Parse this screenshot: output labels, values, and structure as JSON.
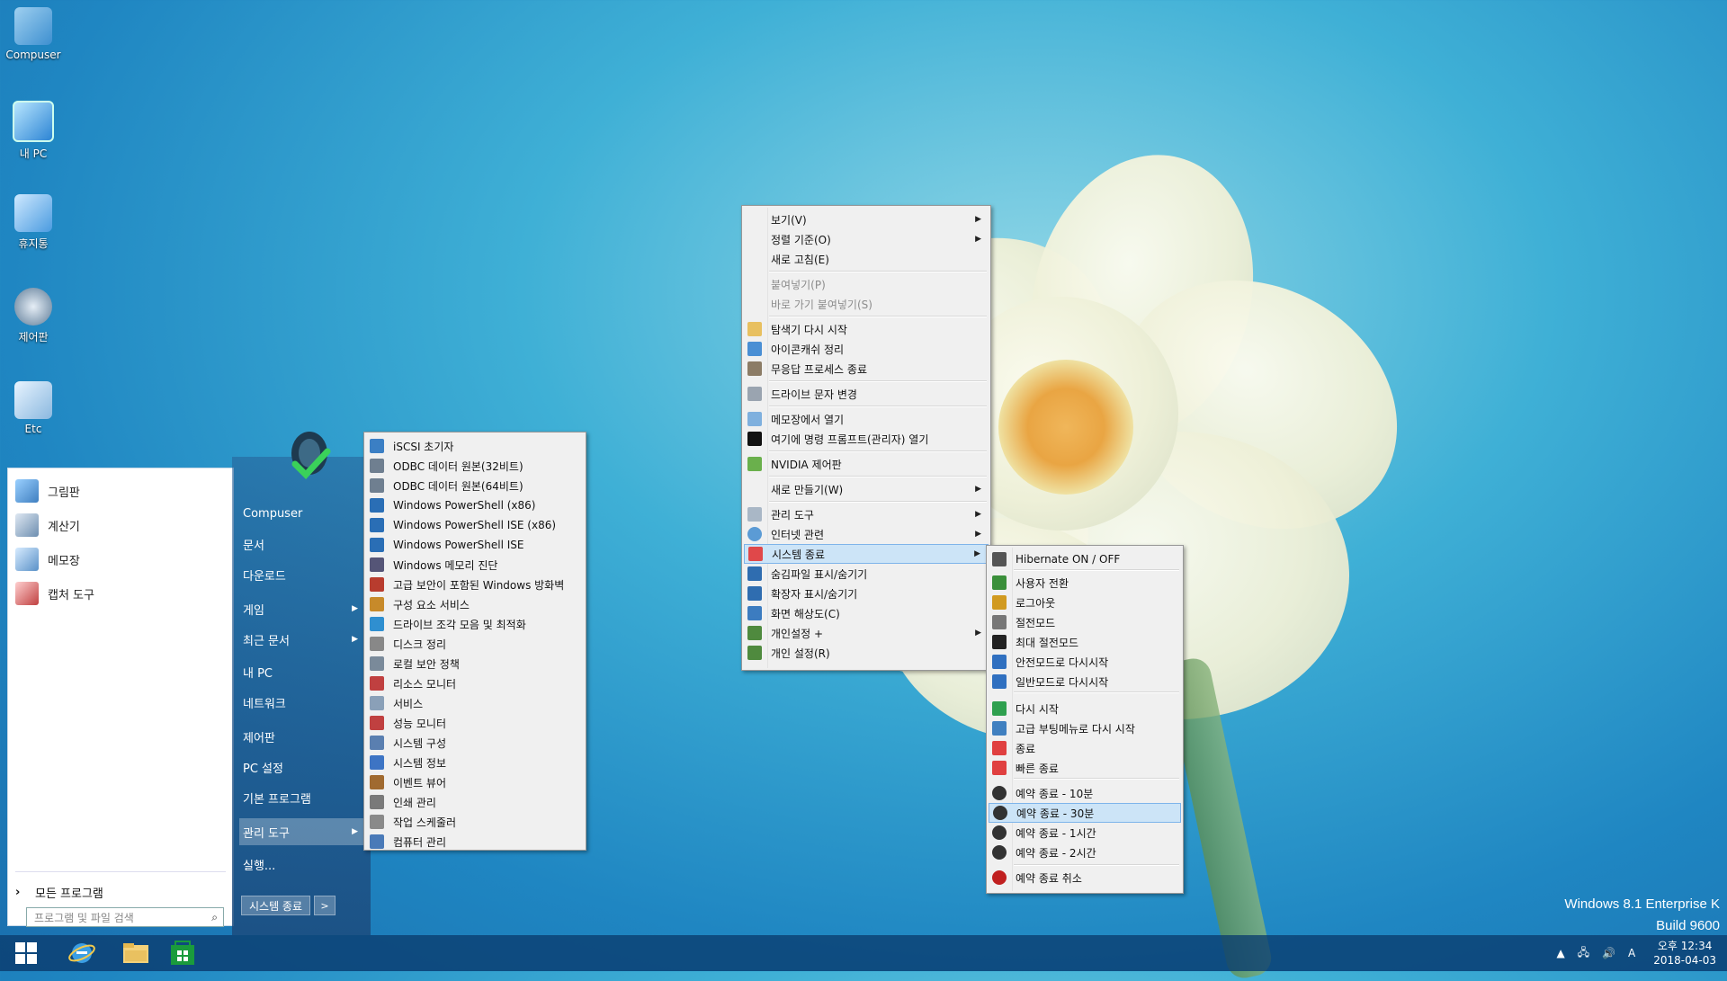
{
  "desktop_icons": [
    {
      "label": "Compuser",
      "icon": "user-folder-icon"
    },
    {
      "label": "내 PC",
      "icon": "computer-icon"
    },
    {
      "label": "휴지통",
      "icon": "recycle-bin-icon"
    },
    {
      "label": "제어판",
      "icon": "control-panel-icon"
    },
    {
      "label": "Etc",
      "icon": "folder-icon"
    }
  ],
  "start_menu": {
    "programs": [
      {
        "label": "그림판",
        "icon": "paint-icon"
      },
      {
        "label": "계산기",
        "icon": "calculator-icon"
      },
      {
        "label": "메모장",
        "icon": "notepad-icon"
      },
      {
        "label": "캡처 도구",
        "icon": "snipping-tool-icon"
      }
    ],
    "all_programs": "모든 프로그램",
    "search_placeholder": "프로그램 및 파일 검색",
    "right_items": [
      {
        "label": "Compuser",
        "has_sub": false
      },
      {
        "label": "문서",
        "has_sub": false
      },
      {
        "label": "다운로드",
        "has_sub": false
      },
      {
        "label": "게임",
        "has_sub": true
      },
      {
        "label": "최근 문서",
        "has_sub": true
      },
      {
        "label": "내 PC",
        "has_sub": false
      },
      {
        "label": "네트워크",
        "has_sub": false
      },
      {
        "label": "제어판",
        "has_sub": false
      },
      {
        "label": "PC 설정",
        "has_sub": false
      },
      {
        "label": "기본 프로그램",
        "has_sub": false
      },
      {
        "label": "관리 도구",
        "has_sub": true
      },
      {
        "label": "실행...",
        "has_sub": false
      }
    ],
    "shutdown_label": "시스템 종료",
    "shutdown_arrow": ">"
  },
  "admin_tools_menu": [
    "iSCSI 초기자",
    "ODBC 데이터 원본(32비트)",
    "ODBC 데이터 원본(64비트)",
    "Windows PowerShell (x86)",
    "Windows PowerShell ISE (x86)",
    "Windows PowerShell ISE",
    "Windows 메모리 진단",
    "고급 보안이 포함된 Windows 방화벽",
    "구성 요소 서비스",
    "드라이브 조각 모음 및 최적화",
    "디스크 정리",
    "로컬 보안 정책",
    "리소스 모니터",
    "서비스",
    "성능 모니터",
    "시스템 구성",
    "시스템 정보",
    "이벤트 뷰어",
    "인쇄 관리",
    "작업 스케줄러",
    "컴퓨터 관리"
  ],
  "context_menu": {
    "view": "보기(V)",
    "sort": "정렬 기준(O)",
    "refresh": "새로 고침(E)",
    "paste": "붙여넣기(P)",
    "paste_shortcut": "바로 가기 붙여넣기(S)",
    "restart_explorer": "탐색기 다시 시작",
    "icon_cache": "아이콘캐쉬 정리",
    "kill_hung": "무응답 프로세스 종료",
    "drive_letter": "드라이브 문자 변경",
    "open_notepad": "메모장에서 열기",
    "open_cmd": "여기에 명령 프롬프트(관리자) 열기",
    "nvidia": "NVIDIA 제어판",
    "new": "새로 만들기(W)",
    "admin_tools": "관리 도구",
    "internet": "인터넷 관련",
    "shutdown": "시스템 종료",
    "hidden_files": "숨김파일 표시/숨기기",
    "extensions": "확장자 표시/숨기기",
    "resolution": "화면 해상도(C)",
    "personalize_plus": "개인설정 +",
    "personalize": "개인 설정(R)"
  },
  "shutdown_menu": [
    "Hibernate ON / OFF",
    "사용자 전환",
    "로그아웃",
    "절전모드",
    "최대 절전모드",
    "안전모드로 다시시작",
    "일반모드로 다시시작",
    "다시 시작",
    "고급 부팅메뉴로 다시 시작",
    "종료",
    "빠른 종료",
    "예약 종료 - 10분",
    "예약 종료 - 30분",
    "예약 종료 - 1시간",
    "예약 종료 - 2시간",
    "예약 종료 취소"
  ],
  "watermark": {
    "line1": "Windows 8.1 Enterprise K",
    "line2": "Build 9600"
  },
  "tray": {
    "ime": "A",
    "time": "오후 12:34",
    "date": "2018-04-03"
  },
  "colors": {
    "accent": "#1f86c2",
    "highlight": "#cce4f7",
    "taskbar": "#0a3c6e"
  }
}
